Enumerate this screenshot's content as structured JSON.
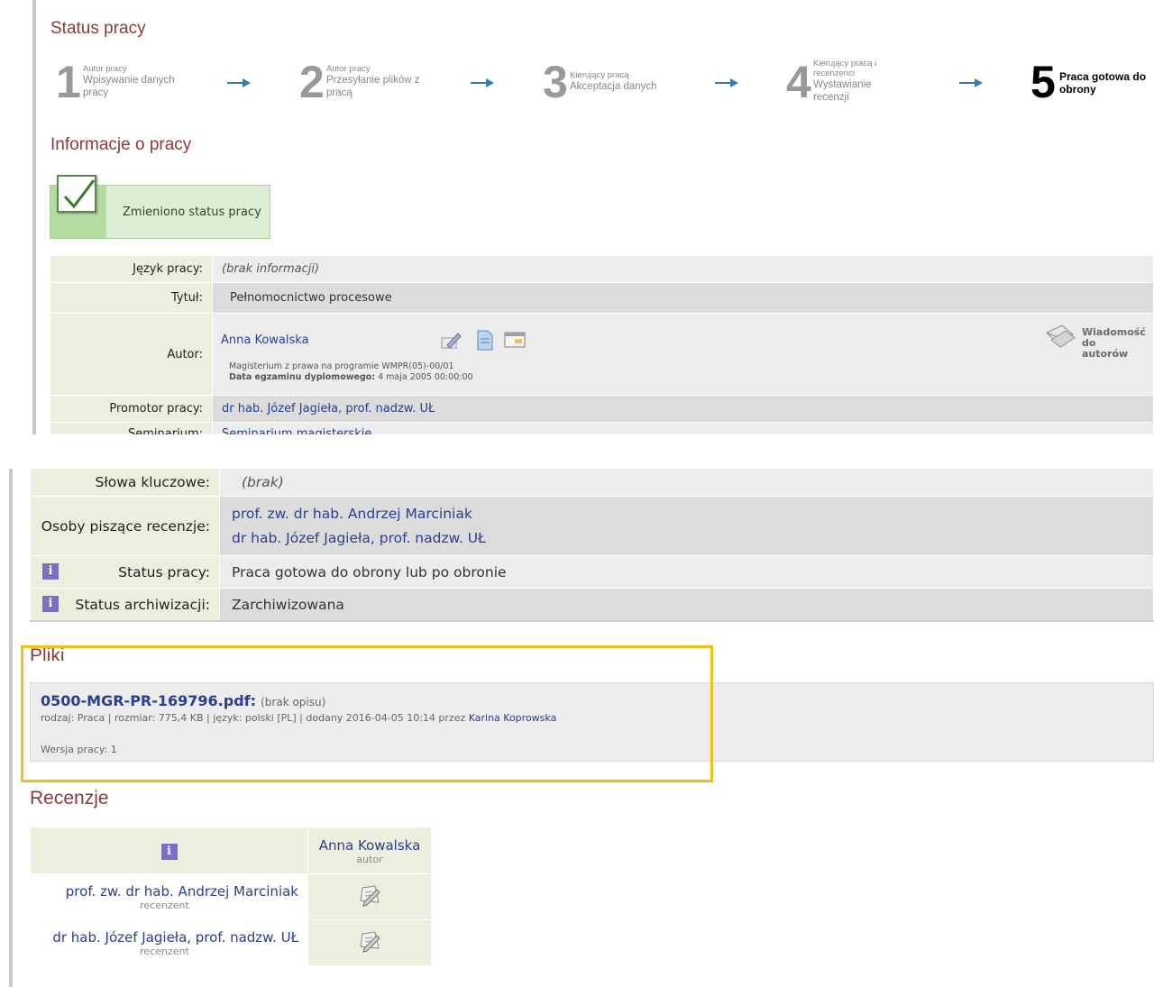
{
  "status": {
    "title": "Status pracy",
    "steps": [
      {
        "num": "1",
        "role": "Autor pracy",
        "name": "Wpisywanie danych pracy"
      },
      {
        "num": "2",
        "role": "Autor pracy",
        "name": "Przesyłanie plików z pracą"
      },
      {
        "num": "3",
        "role": "Kierujący pracą",
        "name": "Akceptacja danych"
      },
      {
        "num": "4",
        "role": "Kierujący pracą i recenzenci",
        "name": "Wystawianie recenzji"
      },
      {
        "num": "5",
        "role": "",
        "name": "Praca gotowa do obrony"
      }
    ]
  },
  "info": {
    "title": "Informacje o pracy",
    "success_msg": "Zmieniono status pracy",
    "rows": {
      "jezyk": {
        "label": "Język pracy:",
        "value": "(brak informacji)"
      },
      "tytul": {
        "label": "Tytuł:",
        "value": "Pełnomocnictwo procesowe"
      },
      "autor": {
        "label": "Autor:",
        "name": "Anna Kowalska",
        "program": "Magisterium z prawa na programie WMPR(05)-00/01",
        "exam_label": "Data egzaminu dyplomowego:",
        "exam_value": "4 maja 2005 00:00:00",
        "message": "Wiadomość do autorów"
      },
      "promotor": {
        "label": "Promotor pracy:",
        "value": "dr hab. Józef Jagieła, prof. nadzw. UŁ"
      },
      "seminarium": {
        "label": "Seminarium:",
        "value": "Seminarium magisterskie"
      },
      "slowa": {
        "label": "Słowa kluczowe:",
        "value": "(brak)"
      },
      "recenzenci": {
        "label": "Osoby piszące recenzje:",
        "values": [
          "prof. zw. dr hab. Andrzej Marciniak",
          "dr hab. Józef Jagieła, prof. nadzw. UŁ"
        ]
      },
      "status": {
        "label": "Status pracy:",
        "value": "Praca gotowa do obrony lub po obronie"
      },
      "archiwizacja": {
        "label": "Status archiwizacji:",
        "value": "Zarchiwizowana"
      }
    }
  },
  "files": {
    "title": "Pliki",
    "name": "0500-MGR-PR-169796.pdf:",
    "desc": "(brak opisu)",
    "meta": "rodzaj: Praca | rozmiar: 775,4 KB | język: polski [PL] | dodany 2016-04-05 10:14 przez",
    "uploader": "Karina Koprowska",
    "version": "Wersja pracy: 1"
  },
  "reviews": {
    "title": "Recenzje",
    "author_name": "Anna Kowalska",
    "author_role": "autor",
    "reviewers": [
      {
        "name": "prof. zw. dr hab. Andrzej Marciniak",
        "role": "recenzent"
      },
      {
        "name": "dr hab. Józef Jagieła, prof. nadzw. UŁ",
        "role": "recenzent"
      }
    ]
  },
  "icons": {
    "info": "i"
  },
  "colors": {
    "heading": "#8b3a3a",
    "link": "#2a3f8f",
    "highlight": "#f2c21b",
    "success": "#dcefd5"
  }
}
